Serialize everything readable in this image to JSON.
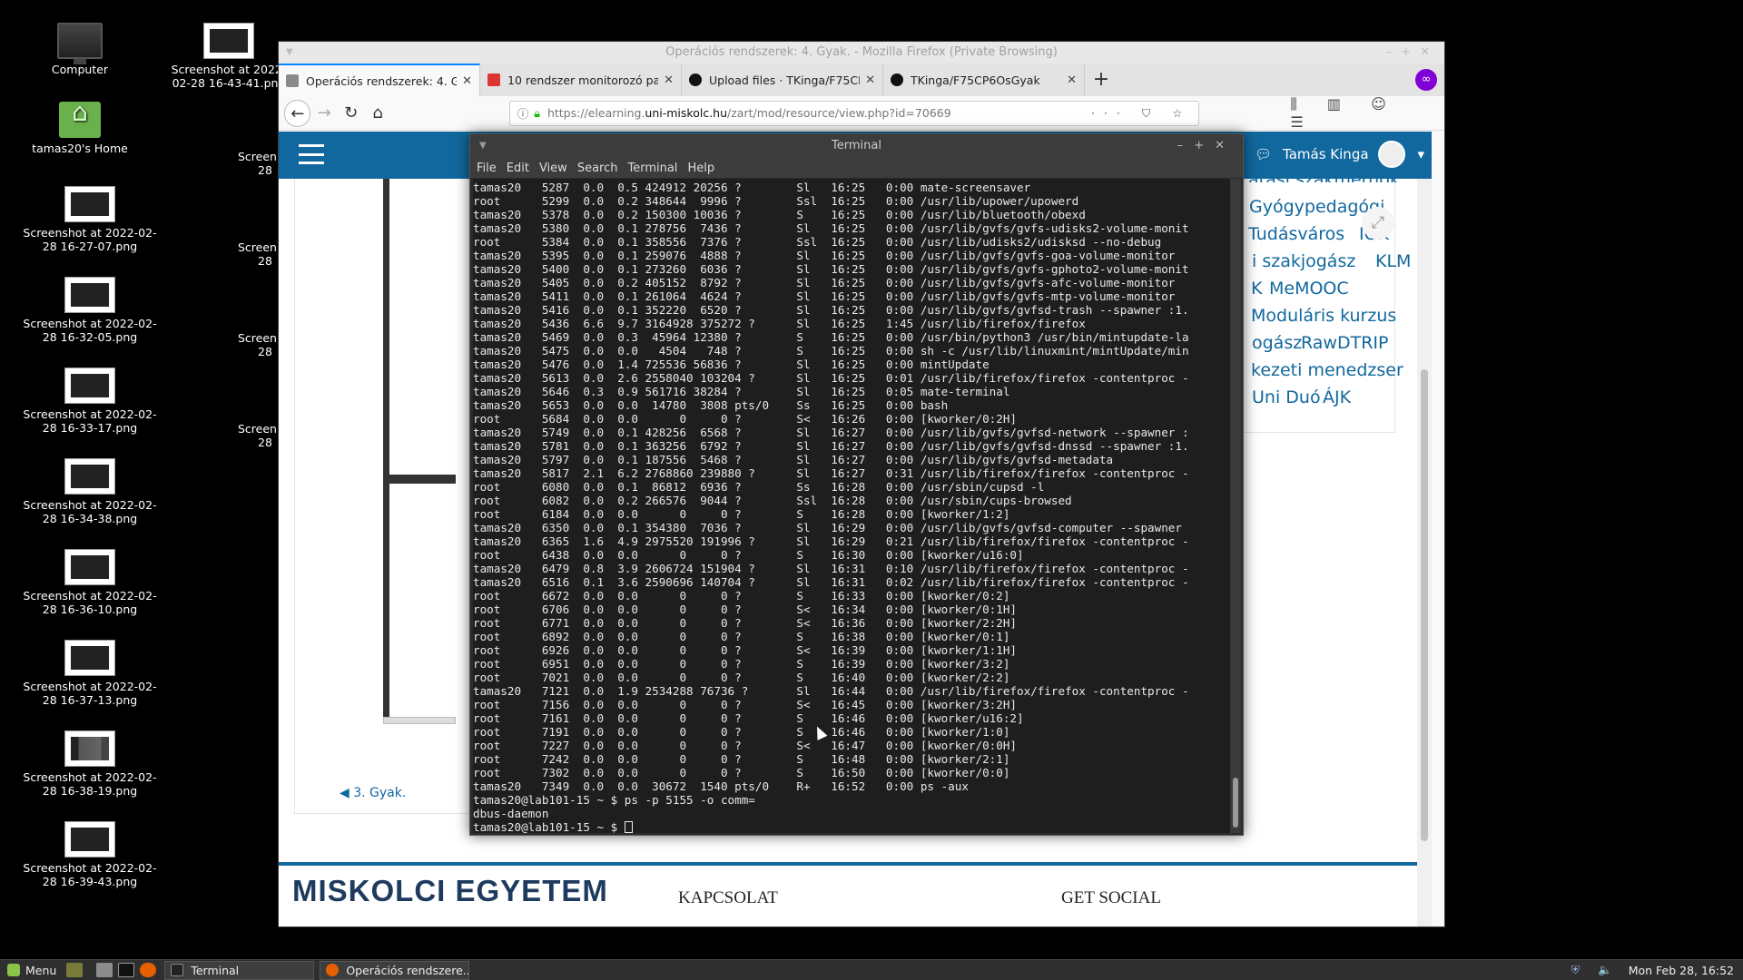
{
  "desktop": {
    "icons": [
      {
        "label": "Computer"
      },
      {
        "label": "tamas20's Home"
      },
      {
        "label": "Screenshot at 2022-02-28 16-27-07.png"
      },
      {
        "label": "Screenshot at 2022-02-28 16-32-05.png"
      },
      {
        "label": "Screenshot at 2022-02-28 16-33-17.png"
      },
      {
        "label": "Screenshot at 2022-02-28 16-34-38.png"
      },
      {
        "label": "Screenshot at 2022-02-28 16-36-10.png"
      },
      {
        "label": "Screenshot at 2022-02-28 16-37-13.png"
      },
      {
        "label": "Screenshot at 2022-02-28 16-38-19.png"
      },
      {
        "label": "Screenshot at 2022-02-28 16-39-43.png"
      },
      {
        "label": "Screenshot at 2022-02-28 16-43-41.png"
      }
    ],
    "partial_labels": [
      "Screen",
      "28",
      "Screen",
      "28",
      "Screen",
      "28",
      "Screen",
      "28"
    ]
  },
  "firefox": {
    "title": "Operációs rendszerek: 4. Gyak. - Mozilla Firefox (Private Browsing)",
    "tabs": [
      {
        "label": "Operációs rendszerek: 4. Gya",
        "active": true,
        "favicon_color": "#8a8a8a"
      },
      {
        "label": "10 rendszer monitorozó para",
        "active": false,
        "favicon_color": "#d33"
      },
      {
        "label": "Upload files · TKinga/F75CP6",
        "active": false,
        "favicon_color": "#111"
      },
      {
        "label": "TKinga/F75CP6OsGyak",
        "active": false,
        "favicon_color": "#111"
      }
    ],
    "url_prefix": "https://elearning.",
    "url_domain": "uni-miskolc.hu",
    "url_suffix": "/zart/mod/resource/view.php?id=70669",
    "url_icons": "··· ⛉ ☆",
    "nav_right_icons": "⫼ ▥ ☺ ☰",
    "page": {
      "user_name": "Tamás Kinga",
      "tags": [
        "atasi szakmérnök",
        "Gyógypedagógi",
        "Tudásváros",
        "IOK",
        "i szakjogász",
        "KLM",
        "K",
        "MeMOOC",
        "Moduláris kurzus",
        "ogász",
        "RawDTRIP",
        "kezeti menedzser",
        "Uni Duó",
        "ÁJK"
      ],
      "prev_link": "◀ 3. Gyak.",
      "footer_logo": "MISKOLCI EGYETEM",
      "footer_links": [
        "KAPCSOLAT",
        "GET SOCIAL"
      ]
    }
  },
  "terminal": {
    "title": "Terminal",
    "menu": [
      "File",
      "Edit",
      "View",
      "Search",
      "Terminal",
      "Help"
    ],
    "lines": [
      "tamas20   5287  0.0  0.5 424912 20256 ?        Sl   16:25   0:00 mate-screensaver",
      "root      5299  0.0  0.2 348644  9996 ?        Ssl  16:25   0:00 /usr/lib/upower/upowerd",
      "tamas20   5378  0.0  0.2 150300 10036 ?        S    16:25   0:00 /usr/lib/bluetooth/obexd",
      "tamas20   5380  0.0  0.1 278756  7436 ?        Sl   16:25   0:00 /usr/lib/gvfs/gvfs-udisks2-volume-monit",
      "root      5384  0.0  0.1 358556  7376 ?        Ssl  16:25   0:00 /usr/lib/udisks2/udisksd --no-debug",
      "tamas20   5395  0.0  0.1 259076  4888 ?        Sl   16:25   0:00 /usr/lib/gvfs/gvfs-goa-volume-monitor",
      "tamas20   5400  0.0  0.1 273260  6036 ?        Sl   16:25   0:00 /usr/lib/gvfs/gvfs-gphoto2-volume-monit",
      "tamas20   5405  0.0  0.2 405152  8792 ?        Sl   16:25   0:00 /usr/lib/gvfs/gvfs-afc-volume-monitor",
      "tamas20   5411  0.0  0.1 261064  4624 ?        Sl   16:25   0:00 /usr/lib/gvfs/gvfs-mtp-volume-monitor",
      "tamas20   5416  0.0  0.1 352220  6520 ?        Sl   16:25   0:00 /usr/lib/gvfs/gvfsd-trash --spawner :1.",
      "tamas20   5436  6.6  9.7 3164928 375272 ?      Sl   16:25   1:45 /usr/lib/firefox/firefox",
      "tamas20   5469  0.0  0.3  45964 12380 ?        S    16:25   0:00 /usr/bin/python3 /usr/bin/mintupdate-la",
      "tamas20   5475  0.0  0.0   4504   748 ?        S    16:25   0:00 sh -c /usr/lib/linuxmint/mintUpdate/min",
      "tamas20   5476  0.0  1.4 725536 56836 ?        Sl   16:25   0:00 mintUpdate",
      "tamas20   5613  0.0  2.6 2558040 103204 ?      Sl   16:25   0:01 /usr/lib/firefox/firefox -contentproc -",
      "tamas20   5646  0.3  0.9 561716 38284 ?        Sl   16:25   0:05 mate-terminal",
      "tamas20   5653  0.0  0.0  14780  3808 pts/0    Ss   16:25   0:00 bash",
      "root      5684  0.0  0.0      0     0 ?        S<   16:26   0:00 [kworker/0:2H]",
      "tamas20   5749  0.0  0.1 428256  6568 ?        Sl   16:27   0:00 /usr/lib/gvfs/gvfsd-network --spawner :",
      "tamas20   5781  0.0  0.1 363256  6792 ?        Sl   16:27   0:00 /usr/lib/gvfs/gvfsd-dnssd --spawner :1.",
      "tamas20   5797  0.0  0.1 187556  5468 ?        Sl   16:27   0:00 /usr/lib/gvfs/gvfsd-metadata",
      "tamas20   5817  2.1  6.2 2768860 239880 ?      Sl   16:27   0:31 /usr/lib/firefox/firefox -contentproc -",
      "root      6080  0.0  0.1  86812  6936 ?        Ss   16:28   0:00 /usr/sbin/cupsd -l",
      "root      6082  0.0  0.2 266576  9044 ?        Ssl  16:28   0:00 /usr/sbin/cups-browsed",
      "root      6184  0.0  0.0      0     0 ?        S    16:28   0:00 [kworker/1:2]",
      "tamas20   6350  0.0  0.1 354380  7036 ?        Sl   16:29   0:00 /usr/lib/gvfs/gvfsd-computer --spawner",
      "tamas20   6365  1.6  4.9 2975520 191996 ?      Sl   16:29   0:21 /usr/lib/firefox/firefox -contentproc -",
      "root      6438  0.0  0.0      0     0 ?        S    16:30   0:00 [kworker/u16:0]",
      "tamas20   6479  0.8  3.9 2606724 151904 ?      Sl   16:31   0:10 /usr/lib/firefox/firefox -contentproc -",
      "tamas20   6516  0.1  3.6 2590696 140704 ?      Sl   16:31   0:02 /usr/lib/firefox/firefox -contentproc -",
      "root      6672  0.0  0.0      0     0 ?        S    16:33   0:00 [kworker/0:2]",
      "root      6706  0.0  0.0      0     0 ?        S<   16:34   0:00 [kworker/0:1H]",
      "root      6771  0.0  0.0      0     0 ?        S<   16:36   0:00 [kworker/2:2H]",
      "root      6892  0.0  0.0      0     0 ?        S    16:38   0:00 [kworker/0:1]",
      "root      6926  0.0  0.0      0     0 ?        S<   16:39   0:00 [kworker/1:1H]",
      "root      6951  0.0  0.0      0     0 ?        S    16:39   0:00 [kworker/3:2]",
      "root      7021  0.0  0.0      0     0 ?        S    16:40   0:00 [kworker/2:2]",
      "tamas20   7121  0.0  1.9 2534288 76736 ?       Sl   16:44   0:00 /usr/lib/firefox/firefox -contentproc -",
      "root      7156  0.0  0.0      0     0 ?        S<   16:45   0:00 [kworker/3:2H]",
      "root      7161  0.0  0.0      0     0 ?        S    16:46   0:00 [kworker/u16:2]",
      "root      7191  0.0  0.0      0     0 ?        S    16:46   0:00 [kworker/1:0]",
      "root      7227  0.0  0.0      0     0 ?        S<   16:47   0:00 [kworker/0:0H]",
      "root      7242  0.0  0.0      0     0 ?        S    16:48   0:00 [kworker/2:1]",
      "root      7302  0.0  0.0      0     0 ?        S    16:50   0:00 [kworker/0:0]",
      "tamas20   7349  0.0  0.0  30672  1540 pts/0    R+   16:52   0:00 ps -aux",
      "tamas20@lab101-15 ~ $ ps -p 5155 -o comm=",
      "dbus-daemon"
    ],
    "prompt": "tamas20@lab101-15 ~ $ "
  },
  "taskbar": {
    "menu_label": "Menu",
    "tasks": [
      {
        "label": "Terminal",
        "icon_color": "#222"
      },
      {
        "label": "Operációs rendszere...",
        "icon_color": "#e66000"
      }
    ],
    "clock": "Mon Feb 28, 16:52",
    "tray_icons": "⛨ 🔈"
  }
}
